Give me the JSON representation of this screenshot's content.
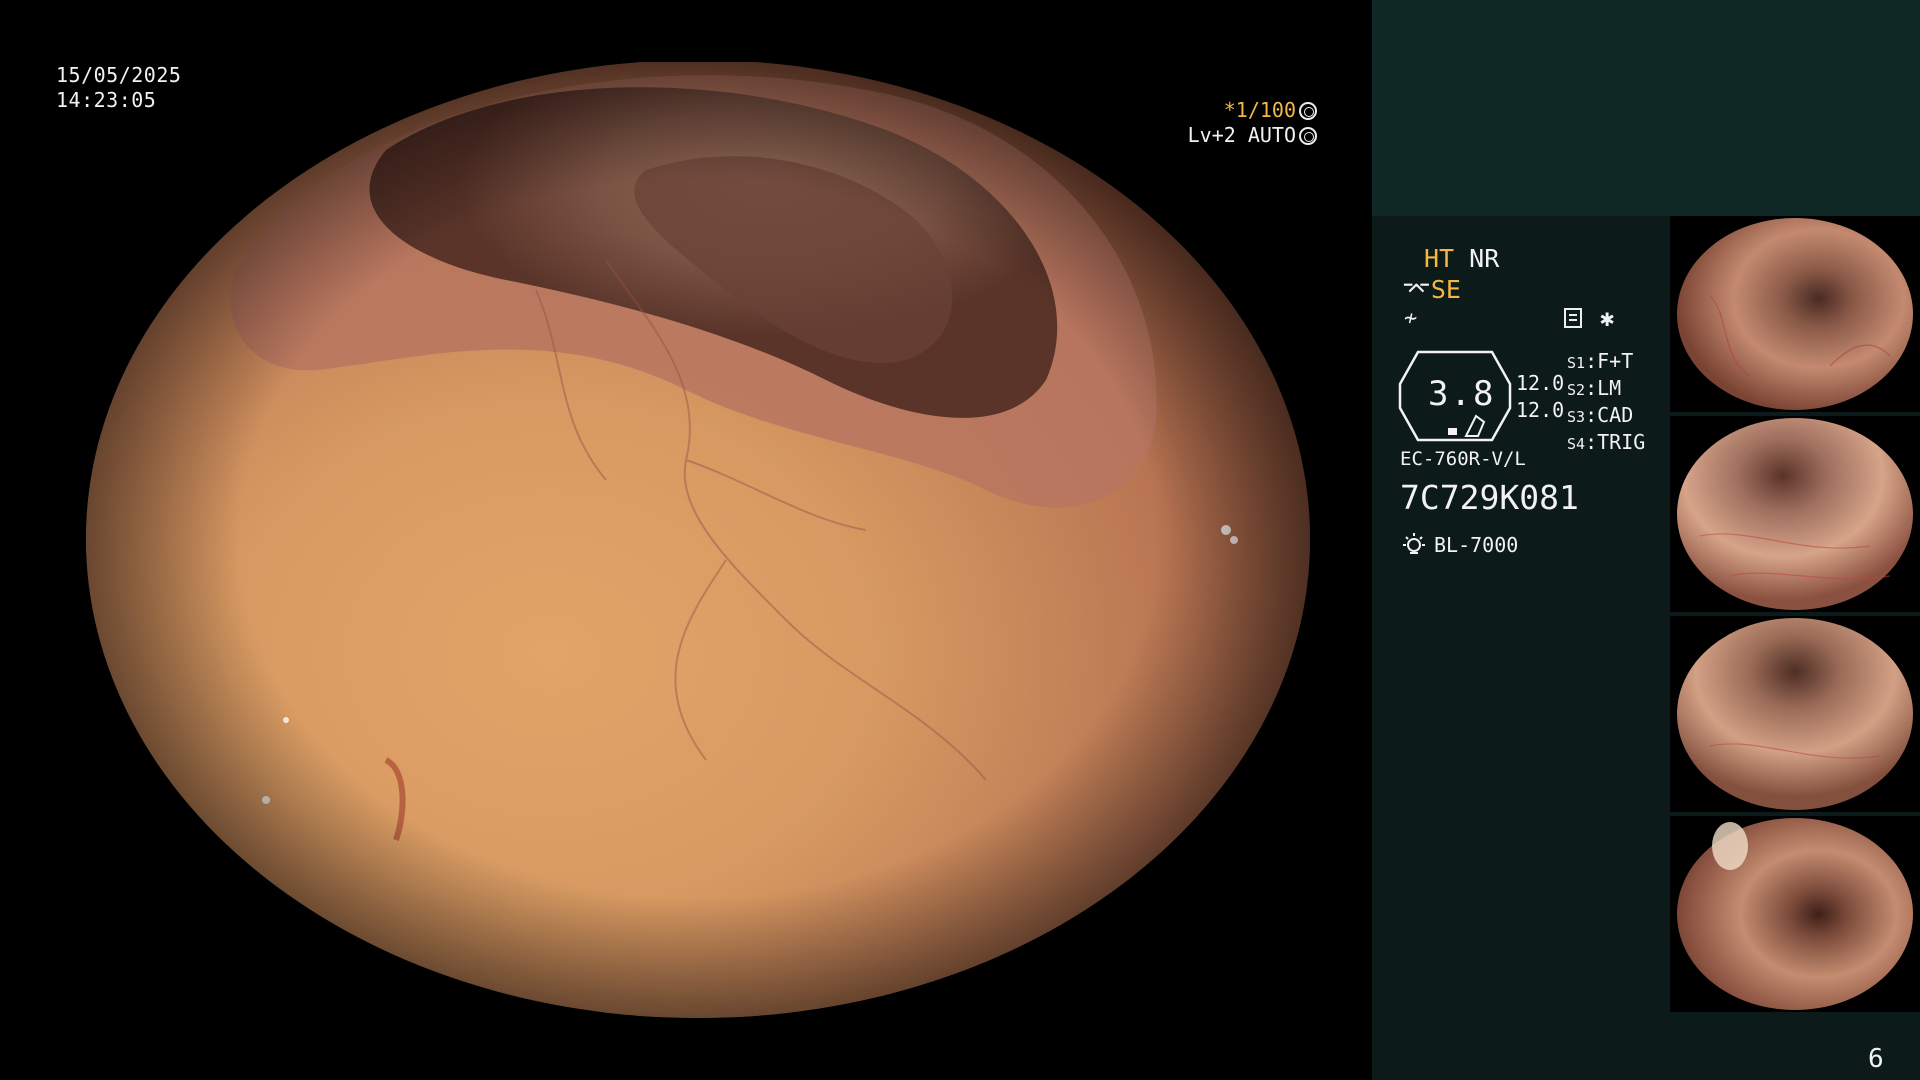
{
  "overlay": {
    "date": "15/05/2025",
    "time": "14:23:05",
    "shutter": "*1/100",
    "level": "Lv+2 AUTO"
  },
  "panel": {
    "ht": "HT",
    "nr": "NR",
    "se": "SE",
    "iris_value": "3.8",
    "iris_sub1": "12.0",
    "iris_sub2": "12.0",
    "slots": [
      {
        "key": "S1",
        "value": "F+T"
      },
      {
        "key": "S2",
        "value": "LM"
      },
      {
        "key": "S3",
        "value": "CAD"
      },
      {
        "key": "S4",
        "value": "TRIG"
      }
    ],
    "scope_model": "EC-760R-V/L",
    "serial": "7C729K081",
    "light_source": "BL-7000",
    "page_number": "6"
  },
  "colors": {
    "panel_bg": "#0c1a19",
    "panel_top": "#0f2826",
    "accent": "#f3b745"
  },
  "thumbnails": [
    {
      "name": "thumbnail-1"
    },
    {
      "name": "thumbnail-2"
    },
    {
      "name": "thumbnail-3"
    },
    {
      "name": "thumbnail-4"
    }
  ]
}
